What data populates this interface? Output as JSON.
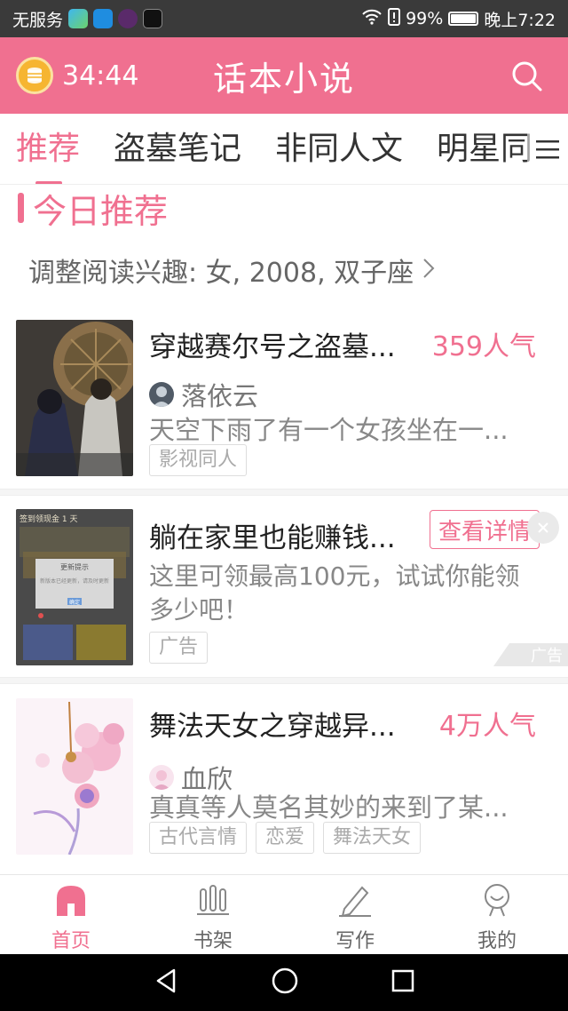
{
  "status_bar": {
    "carrier": "无服务",
    "battery_percent": "99%",
    "battery_level": 0.99,
    "time": "晚上7:22",
    "icons": [
      "video-app-icon",
      "mail-app-icon",
      "game-app-icon",
      "capcut-app-icon",
      "wifi-icon",
      "alert-icon",
      "battery-icon"
    ]
  },
  "header": {
    "timer": "34:44",
    "title": "话本小说",
    "timer_icon": "coin-alarm-icon",
    "search_icon": "search-icon"
  },
  "tabs": {
    "items": [
      "推荐",
      "盗墓笔记",
      "非同人文",
      "明星同"
    ],
    "active_index": 0,
    "more_icon": "menu-icon"
  },
  "section": {
    "title": "今日推荐",
    "interest_text": "调整阅读兴趣: 女, 2008, 双子座"
  },
  "books": [
    {
      "title": "穿越赛尔号之盗墓...",
      "popularity": "359人气",
      "author": "落依云",
      "description": "天空下雨了有一个女孩坐在一...",
      "tags": [
        "影视同人"
      ]
    },
    {
      "title": "舞法天女之穿越异...",
      "popularity": "4万人气",
      "author": "血欣",
      "description": "真真等人莫名其妙的来到了某...",
      "tags": [
        "古代言情",
        "恋爱",
        "舞法天女"
      ]
    }
  ],
  "ad": {
    "title": "躺在家里也能赚钱...",
    "button": "查看详情",
    "description_line1": "这里可领最高100元，试试你能领",
    "description_line2": "多少吧！",
    "tag": "广告",
    "mark": "广告",
    "cover_header": "签到领现金 1 天",
    "cover_dialog_title": "更新提示",
    "cover_dialog_body": "新版本已经更新，请及时更新",
    "cover_dialog_button": "确定"
  },
  "bottom_nav": {
    "items": [
      {
        "label": "首页",
        "icon": "home-icon"
      },
      {
        "label": "书架",
        "icon": "bookshelf-icon"
      },
      {
        "label": "写作",
        "icon": "pencil-icon"
      },
      {
        "label": "我的",
        "icon": "profile-icon"
      }
    ],
    "active_index": 0
  },
  "colors": {
    "brand": "#f07090",
    "status_bar": "#3a3a3a",
    "timer_coin": "#f6b531"
  }
}
